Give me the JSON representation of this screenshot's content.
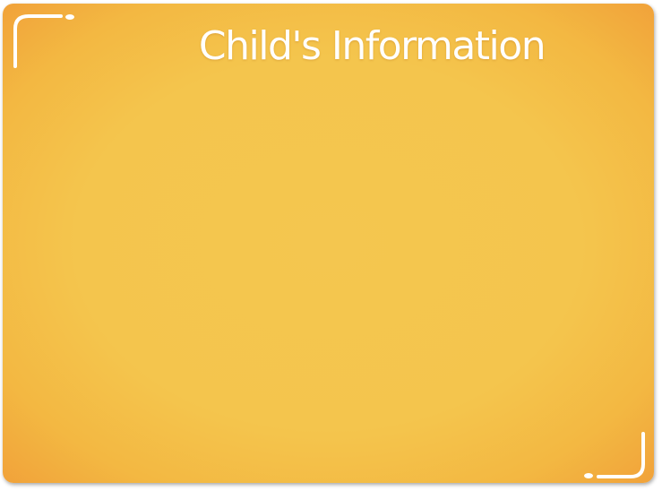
{
  "slide": {
    "title": "Child's Information"
  },
  "decorations": {
    "top_left": "corner-bracket-icon",
    "bottom_right": "corner-bracket-icon"
  },
  "colors": {
    "background": "#f4c54d",
    "edge": "#f1a23a",
    "accent": "#ffffff"
  }
}
